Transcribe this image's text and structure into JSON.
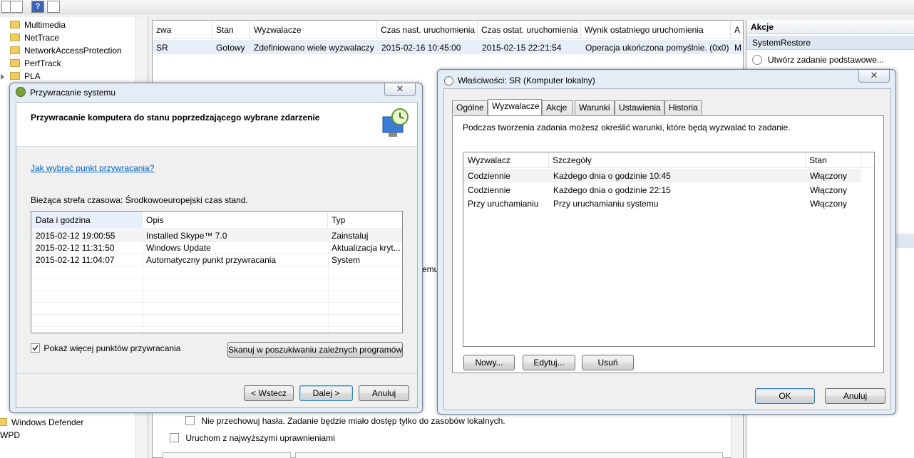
{
  "toolbar": {
    "help_glyph": "?"
  },
  "tree": {
    "items": [
      "Multimedia",
      "NetTrace",
      "NetworkAccessProtection",
      "PerfTrack",
      "PLA"
    ],
    "bottom_items": [
      "Windows Defender",
      "WPD"
    ]
  },
  "task_list": {
    "columns": [
      "zwa",
      "Stan",
      "Wyzwalacze",
      "Czas nast. uruchomienia",
      "Czas ostat. uruchomienia",
      "Wynik ostatniego uruchomienia",
      "A"
    ],
    "row": [
      "SR",
      "Gotowy",
      "Zdefiniowano wiele wyzwalaczy",
      "2015-02-16 10:45:00",
      "2015-02-15 22:21:54",
      "Operacja ukończona pomyślnie. (0x0)",
      "M"
    ],
    "partial_text": "emu",
    "security_options": {
      "no_password": "Nie przechowuj hasła. Zadanie będzie miało dostęp tylko do zasobów lokalnych.",
      "highest_privileges": "Uruchom z najwyższymi uprawnieniami"
    }
  },
  "actions_pane": {
    "title": "Akcje",
    "section": "SystemRestore",
    "items": [
      "Utwórz zadanie podstawowe..."
    ]
  },
  "restore_dialog": {
    "title": "Przywracanie systemu",
    "close": "✕",
    "heading": "Przywracanie komputera do stanu poprzedzającego wybrane zdarzenie",
    "help_link": "Jak wybrać punkt przywracania?",
    "timezone": "Bieżąca strefa czasowa: Środkowoeuropejski czas stand.",
    "columns": [
      "Data i godzina",
      "Opis",
      "Typ"
    ],
    "rows": [
      [
        "2015-02-12 19:00:55",
        "Installed Skype™ 7.0",
        "Zainstaluj"
      ],
      [
        "2015-02-12 11:31:50",
        "Windows Update",
        "Aktualizacja kryt..."
      ],
      [
        "2015-02-12 11:04:07",
        "Automatyczny punkt przywracania",
        "System"
      ]
    ],
    "show_more": "Pokaż więcej punktów przywracania",
    "show_more_checked": true,
    "scan_button": "Skanuj w poszukiwaniu zależnych programów",
    "back_button": "< Wstecz",
    "next_button": "Dalej >",
    "cancel_button": "Anuluj"
  },
  "properties_dialog": {
    "title": "Właściwości: SR (Komputer lokalny)",
    "close": "✕",
    "tabs": [
      "Ogólne",
      "Wyzwalacze",
      "Akcje",
      "Warunki",
      "Ustawienia",
      "Historia"
    ],
    "active_tab": "Wyzwalacze",
    "description": "Podczas tworzenia zadania możesz określić warunki, które będą wyzwalać to zadanie.",
    "columns": [
      "Wyzwalacz",
      "Szczegóły",
      "Stan"
    ],
    "rows": [
      [
        "Codziennie",
        "Każdego dnia o godzinie 10:45",
        "Włączony"
      ],
      [
        "Codziennie",
        "Każdego dnia o godzinie 22:15",
        "Włączony"
      ],
      [
        "Przy uruchamianiu",
        "Przy uruchamianiu systemu",
        "Włączony"
      ]
    ],
    "new_button": "Nowy...",
    "edit_button": "Edytuj...",
    "delete_button": "Usuń",
    "ok_button": "OK",
    "cancel_button": "Anuluj"
  }
}
